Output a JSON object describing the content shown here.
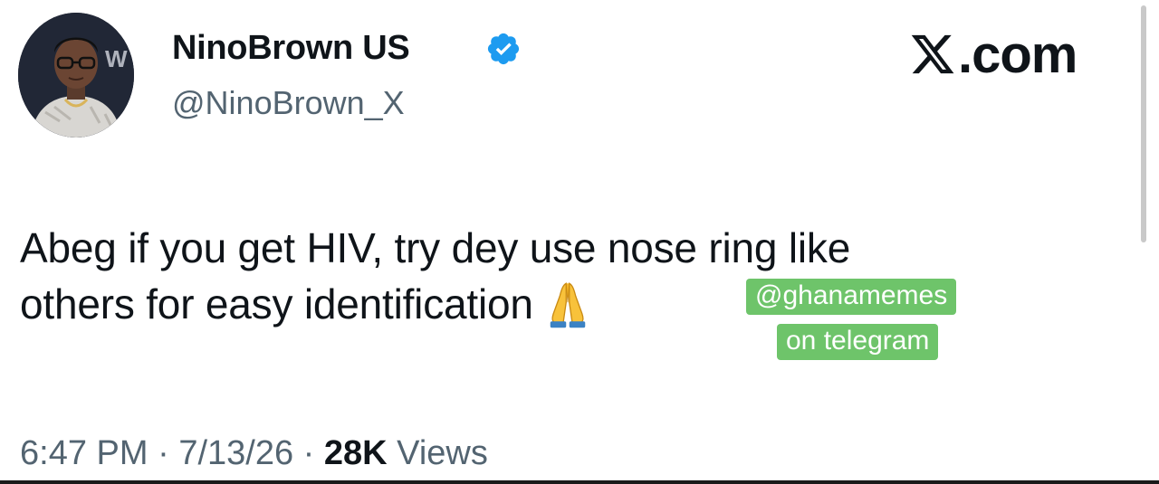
{
  "tweet": {
    "author": {
      "display_name": "NinoBrown US",
      "handle": "@NinoBrown_X",
      "verified": true,
      "badge_color": "#1d9bf0"
    },
    "text_lines": [
      "Abeg if you get HIV, try dey use nose ring like",
      "others for easy identification"
    ],
    "emoji": "folded-hands",
    "meta": {
      "time": "6:47 PM",
      "separator": "·",
      "date": "7/13/26",
      "views_count": "28K",
      "views_label": "Views"
    }
  },
  "watermark": {
    "brand": ".com",
    "brand_icon": "x-logo-icon"
  },
  "overlay_sticker": {
    "line1": "@ghanamemes",
    "line2": "on telegram",
    "color": "#6ec46a"
  },
  "colors": {
    "text_primary": "#0f1419",
    "text_secondary": "#536471",
    "background": "#ffffff"
  }
}
